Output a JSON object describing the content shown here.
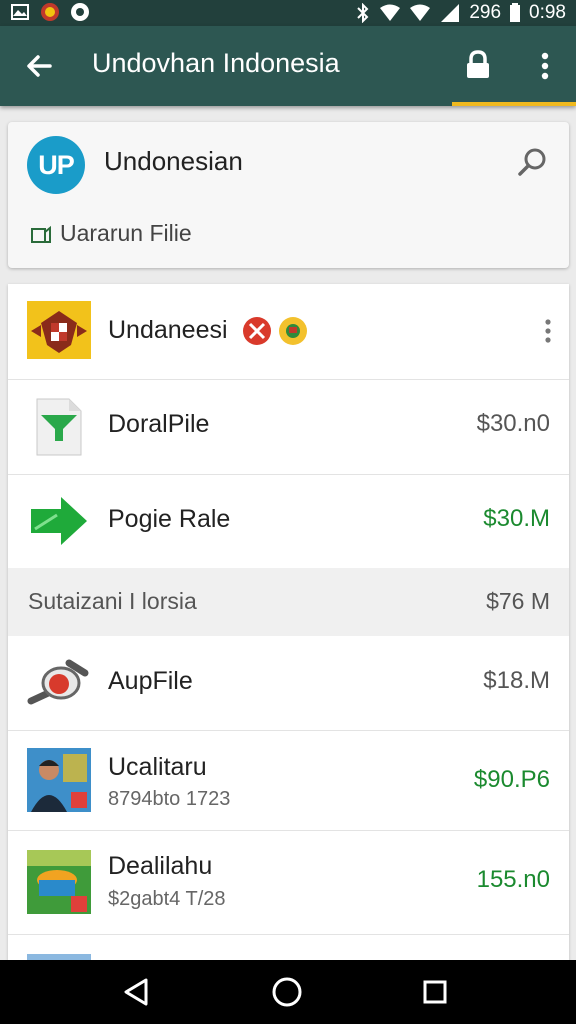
{
  "status_bar": {
    "battery": "296",
    "time": "0:98",
    "icons": [
      "image-icon",
      "flag-badge-icon",
      "shield-icon",
      "bluetooth-icon",
      "wifi-icon",
      "signal-icon",
      "battery-icon"
    ]
  },
  "toolbar": {
    "title": "Undovhan Indonesia",
    "icons": [
      "back-arrow-icon",
      "lock-icon",
      "more-vertical-icon"
    ],
    "accent": "#f0b91e",
    "background": "#2d5752"
  },
  "app_card": {
    "logo_text": "UP",
    "name": "Undonesian",
    "subtitle": "Uararun Filie"
  },
  "list": {
    "rows": [
      {
        "name": "Undaneesi",
        "value": "",
        "icon": "garuda-emblem-icon"
      },
      {
        "name": "DoralPile",
        "value": "$30.n0",
        "icon": "document-icon",
        "value_color": "#555555"
      },
      {
        "name": "Pogie Rale",
        "value": "$30.M",
        "icon": "green-arrow-icon",
        "value_color": "#1b8a2f"
      }
    ],
    "section": {
      "name": "Sutaizani I lorsia",
      "value": "$76 M"
    },
    "rows2": [
      {
        "name": "AupFile",
        "value": "$18.M",
        "icon": "pin-icon",
        "value_color": "#555555"
      },
      {
        "name": "Ucalitaru",
        "sub": "8794bto 1723",
        "value": "$90.P6",
        "icon": "portrait-icon",
        "value_color": "#1b8a2f"
      },
      {
        "name": "Dealilahu",
        "sub": "$2gabt4 T/28",
        "value": "155.n0",
        "icon": "game-icon",
        "value_color": "#1b8a2f"
      }
    ]
  },
  "navbar": {
    "icons": [
      "back-triangle-icon",
      "home-circle-icon",
      "recents-square-icon"
    ]
  }
}
